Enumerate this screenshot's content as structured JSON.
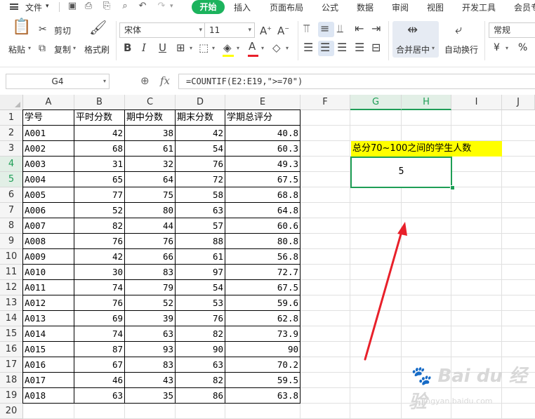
{
  "menu": {
    "file": "文件",
    "tabs": [
      "开始",
      "插入",
      "页面布局",
      "公式",
      "数据",
      "审阅",
      "视图",
      "开发工具",
      "会员专"
    ]
  },
  "ribbon": {
    "paste": "粘贴",
    "cut": "剪切",
    "copy": "复制",
    "format_painter": "格式刷",
    "font_name": "宋体",
    "font_size": "11",
    "merge_center": "合并居中",
    "wrap_text": "自动换行",
    "number_format": "常规",
    "currency_symbol": "¥",
    "percent_symbol": "%"
  },
  "formula_bar": {
    "cell_ref": "G4",
    "fx": "fx",
    "formula": "=COUNTIF(E2:E19,\">=70\")"
  },
  "columns": [
    "A",
    "B",
    "C",
    "D",
    "E",
    "F",
    "G",
    "H",
    "I",
    "J"
  ],
  "rows": [
    "1",
    "2",
    "3",
    "4",
    "5",
    "6",
    "7",
    "8",
    "9",
    "10",
    "11",
    "12",
    "13",
    "14",
    "15",
    "16",
    "17",
    "18",
    "19",
    "20"
  ],
  "table": {
    "headers": [
      "学号",
      "平时分数",
      "期中分数",
      "期末分数",
      "学期总评分"
    ],
    "data": [
      [
        "A001",
        "42",
        "38",
        "42",
        "40.8"
      ],
      [
        "A002",
        "68",
        "61",
        "54",
        "60.3"
      ],
      [
        "A003",
        "31",
        "32",
        "76",
        "49.3"
      ],
      [
        "A004",
        "65",
        "64",
        "72",
        "67.5"
      ],
      [
        "A005",
        "77",
        "75",
        "58",
        "68.8"
      ],
      [
        "A006",
        "52",
        "80",
        "63",
        "64.8"
      ],
      [
        "A007",
        "82",
        "44",
        "57",
        "60.6"
      ],
      [
        "A008",
        "76",
        "76",
        "88",
        "80.8"
      ],
      [
        "A009",
        "42",
        "66",
        "61",
        "56.8"
      ],
      [
        "A010",
        "30",
        "83",
        "97",
        "72.7"
      ],
      [
        "A011",
        "74",
        "79",
        "54",
        "67.5"
      ],
      [
        "A012",
        "76",
        "52",
        "53",
        "59.6"
      ],
      [
        "A013",
        "69",
        "39",
        "76",
        "62.8"
      ],
      [
        "A014",
        "74",
        "63",
        "82",
        "73.9"
      ],
      [
        "A015",
        "87",
        "93",
        "90",
        "90"
      ],
      [
        "A016",
        "67",
        "83",
        "63",
        "70.2"
      ],
      [
        "A017",
        "46",
        "43",
        "82",
        "59.5"
      ],
      [
        "A018",
        "63",
        "35",
        "86",
        "63.8"
      ]
    ]
  },
  "label_cell": "总分70~100之间的学生人数",
  "result_value": "5",
  "watermark": {
    "brand": "Bai du 经验",
    "url": "jingyan.baidu.com"
  },
  "colors": {
    "accent": "#1cb35d",
    "highlight": "#ffff00",
    "arrow": "#e8202a",
    "selection": "#1e9e56"
  }
}
